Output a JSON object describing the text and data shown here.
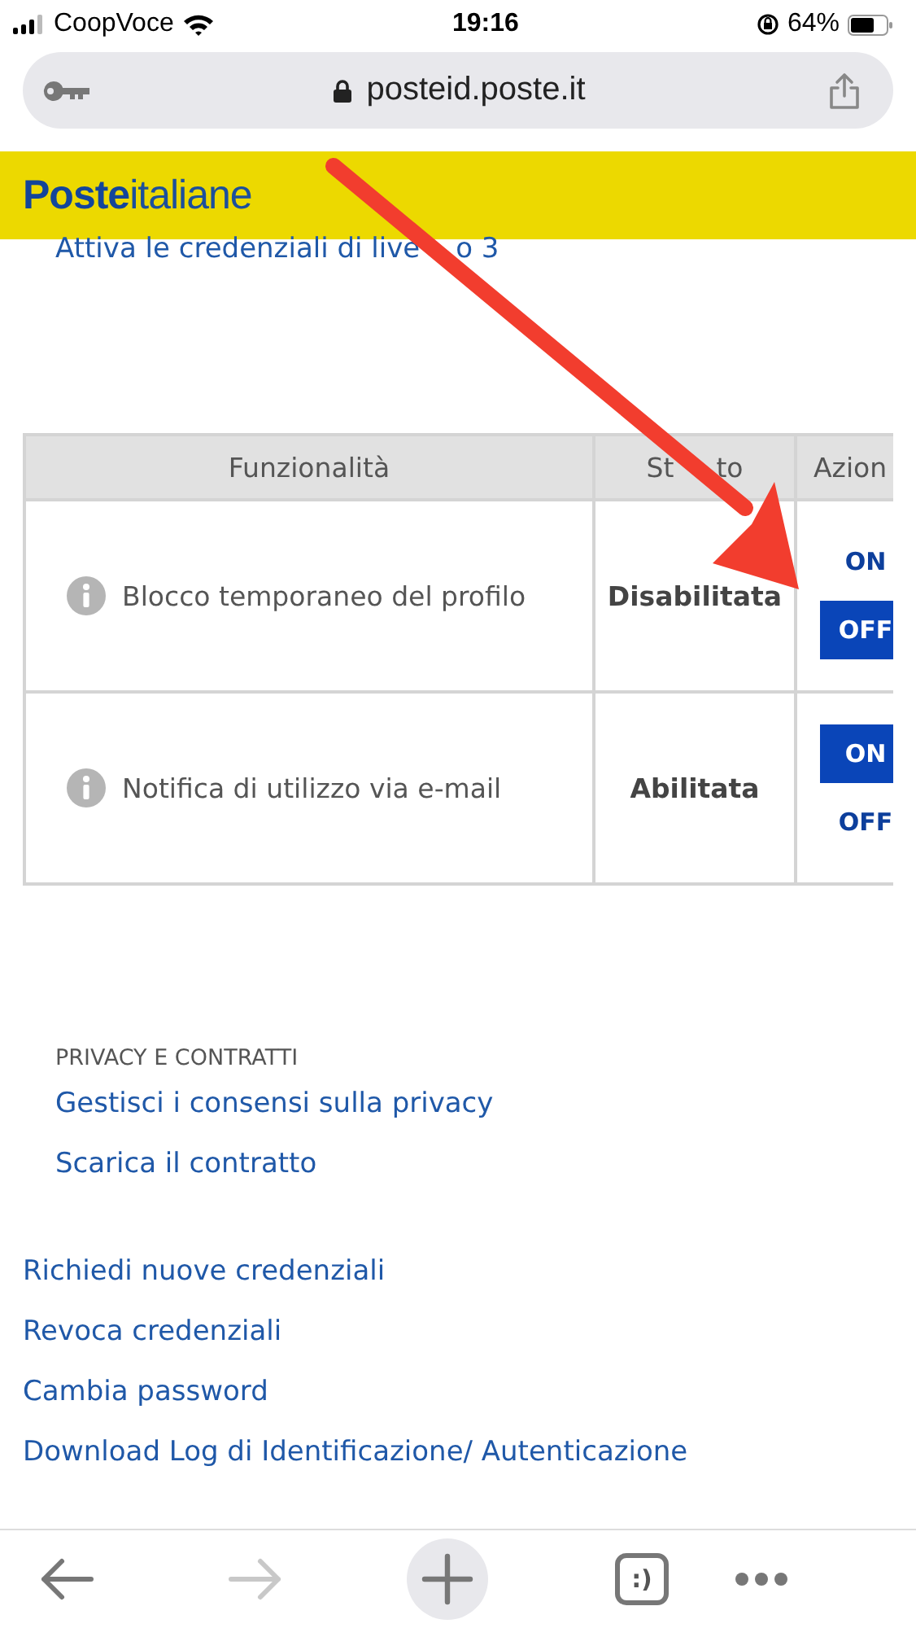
{
  "status_bar": {
    "carrier": "CoopVoce",
    "time": "19:16",
    "battery": "64%"
  },
  "address_bar": {
    "url": "posteid.poste.it"
  },
  "header": {
    "logo": "**Poste**italiane"
  },
  "top_link": {
    "visible_parts": [
      "Attiva le credenziali di live",
      "o 3"
    ]
  },
  "table": {
    "columns": [
      {
        "visible_parts": [
          "Funzionalità"
        ]
      },
      {
        "visible_parts": [
          "St",
          "to"
        ]
      },
      {
        "visible_parts": [
          "Azion"
        ]
      }
    ],
    "rows": [
      {
        "feature": "Blocco temporaneo del profilo",
        "status": "Disabilitata",
        "actions": [
          {
            "label": "ON",
            "selected": false
          },
          {
            "label": "OFF",
            "selected": true
          }
        ]
      },
      {
        "feature": "Notifica di utilizzo via e-mail",
        "status": "Abilitata",
        "actions": [
          {
            "label": "ON",
            "selected": true
          },
          {
            "label": "OFF",
            "selected": false
          }
        ]
      }
    ]
  },
  "privacy": {
    "heading": "PRIVACY E CONTRATTI",
    "links": [
      "Gestisci i consensi sulla privacy",
      "Scarica il contratto"
    ]
  },
  "links": [
    "Richiedi nuove credenziali",
    "Revoca credenziali",
    "Cambia password",
    "Download Log di Identificazione/ Autenticazione"
  ],
  "toolbar": {
    "tabs_label": ":)"
  }
}
